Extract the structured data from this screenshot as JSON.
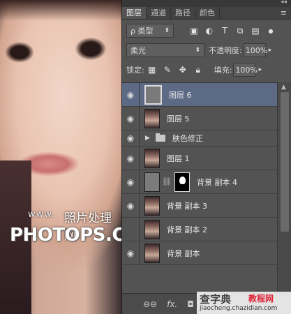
{
  "photo": {
    "watermark_url": "www.",
    "watermark_cn": "照片处理网",
    "watermark_big": "PHOTOPS.COM"
  },
  "panel": {
    "collapse": "◂◂",
    "menu_icon": "≡",
    "tabs": [
      {
        "label": "图层",
        "active": true
      },
      {
        "label": "通道",
        "active": false
      },
      {
        "label": "路径",
        "active": false
      },
      {
        "label": "颜色",
        "active": false
      }
    ],
    "filter": {
      "label": "ρ 类型"
    },
    "blend": {
      "mode": "柔光",
      "opacity_label": "不透明度:",
      "opacity_value": "100%"
    },
    "lock": {
      "label": "锁定:",
      "fill_label": "填充:",
      "fill_value": "100%"
    },
    "layers": [
      {
        "name": "图层 6",
        "selected": true,
        "visible": true,
        "kind": "gray"
      },
      {
        "name": "图层 5",
        "selected": false,
        "visible": true,
        "kind": "photo"
      },
      {
        "name": "肤色修正",
        "selected": false,
        "visible": true,
        "kind": "group"
      },
      {
        "name": "图层 1",
        "selected": false,
        "visible": true,
        "kind": "photo"
      },
      {
        "name": "背景 副本 4",
        "selected": false,
        "visible": true,
        "kind": "masked"
      },
      {
        "name": "背景 副本 3",
        "selected": false,
        "visible": true,
        "kind": "photo"
      },
      {
        "name": "背景 副本 2",
        "selected": false,
        "visible": false,
        "kind": "photo"
      },
      {
        "name": "背景 副本",
        "selected": false,
        "visible": true,
        "kind": "photo"
      }
    ],
    "footer": {
      "link": "⊖⊖",
      "fx": "fx.",
      "mask": "◘"
    }
  },
  "watermark2": {
    "title_a": "查字典",
    "tag": "教程网",
    "url": "jiaocheng.chazidian.com"
  }
}
